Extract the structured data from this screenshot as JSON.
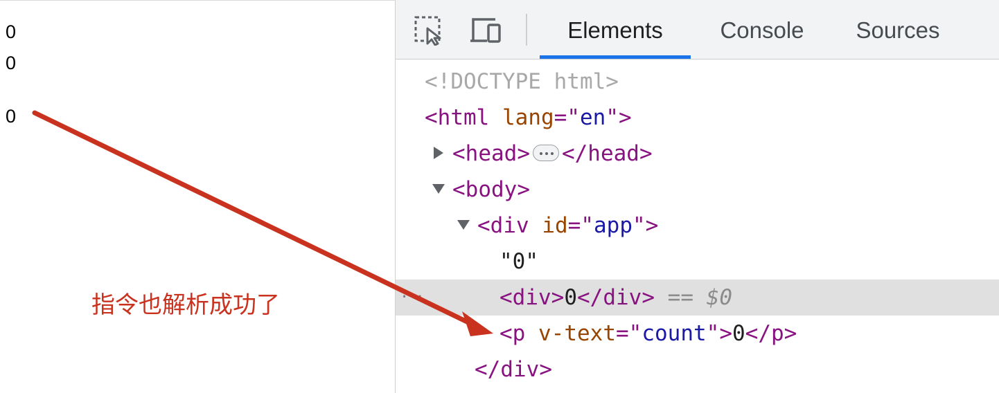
{
  "page_preview": {
    "lines": [
      "0",
      "0",
      "0"
    ]
  },
  "annotation": {
    "note": "指令也解析成功了",
    "color": "#c8321e"
  },
  "devtools": {
    "toolbar": {
      "inspect_icon": "inspect-element-icon",
      "device_icon": "device-toolbar-icon",
      "tabs": [
        "Elements",
        "Console",
        "Sources"
      ],
      "active_tab": "Elements",
      "accent": "#1a73e8"
    },
    "tree": {
      "doctype": "<!DOCTYPE html>",
      "html_open": {
        "lt": "<",
        "tag": "html",
        "attr": "lang",
        "eq": "=\"",
        "value": "en",
        "close": "\">"
      },
      "head": {
        "open": "<head>",
        "close": "</head>"
      },
      "body_open": "<body>",
      "div_open": {
        "lt": "<",
        "tag": "div",
        "attr": "id",
        "eq": "=\"",
        "value": "app",
        "close": "\">"
      },
      "text_node": "\"0\"",
      "selected_div": {
        "open": "<div>",
        "text": "0",
        "close": "</div>",
        "eq_sign": "==",
        "ref": "$0"
      },
      "p_node": {
        "lt": "<",
        "tag": "p",
        "attr": "v-text",
        "eq": "=\"",
        "value": "count",
        "close_open": "\">",
        "text": "0",
        "close": "</p>"
      },
      "div_close": "</div>",
      "gutter_dots": "···"
    },
    "colors": {
      "tag": "#881280",
      "attribute": "#994500",
      "value": "#1a1aa6",
      "selected_row": "#e0e0e0"
    }
  }
}
